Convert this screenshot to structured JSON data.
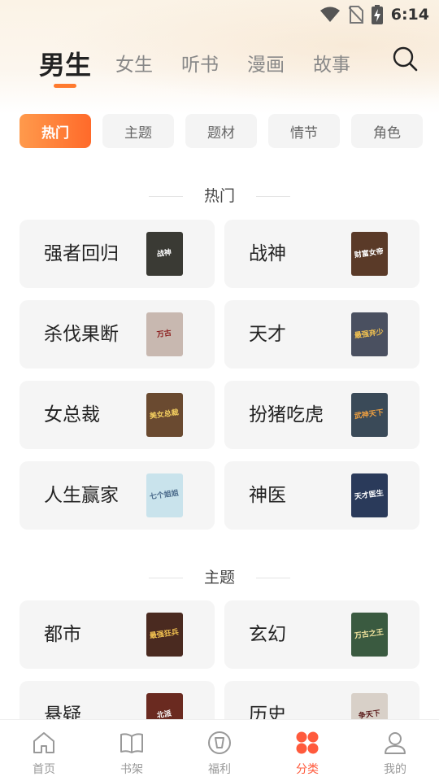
{
  "status_bar": {
    "time": "6:14"
  },
  "top_tabs": [
    {
      "label": "男生",
      "active": true
    },
    {
      "label": "女生"
    },
    {
      "label": "听书"
    },
    {
      "label": "漫画"
    },
    {
      "label": "故事"
    }
  ],
  "search": {
    "icon": "search-icon"
  },
  "chips": [
    {
      "label": "热门",
      "active": true
    },
    {
      "label": "主题"
    },
    {
      "label": "题材"
    },
    {
      "label": "情节"
    },
    {
      "label": "角色"
    }
  ],
  "sections": [
    {
      "title": "热门",
      "cards": [
        {
          "label": "强者回归",
          "cover_text": "战神",
          "cover_color": "#3a3a34"
        },
        {
          "label": "战神",
          "cover_text": "财富女帝",
          "cover_color": "#5a3a28"
        },
        {
          "label": "杀伐果断",
          "cover_text": "万古",
          "cover_color": "#c8b8b0"
        },
        {
          "label": "天才",
          "cover_text": "最强弃少",
          "cover_color": "#4a5060"
        },
        {
          "label": "女总裁",
          "cover_text": "美女总裁",
          "cover_color": "#6a4a30"
        },
        {
          "label": "扮猪吃虎",
          "cover_text": "武神天下",
          "cover_color": "#3a4a58"
        },
        {
          "label": "人生赢家",
          "cover_text": "七个姐姐",
          "cover_color": "#c9e3ec"
        },
        {
          "label": "神医",
          "cover_text": "天才医生",
          "cover_color": "#2a3a5a"
        }
      ]
    },
    {
      "title": "主题",
      "cards": [
        {
          "label": "都市",
          "cover_text": "最强狂兵",
          "cover_color": "#4a2a20"
        },
        {
          "label": "玄幻",
          "cover_text": "万古之王",
          "cover_color": "#3a5a40"
        },
        {
          "label": "悬疑",
          "cover_text": "北派",
          "cover_color": "#6a2a20"
        },
        {
          "label": "历史",
          "cover_text": "争天下",
          "cover_color": "#d8d0c8"
        }
      ]
    }
  ],
  "bottom_nav": [
    {
      "label": "首页",
      "icon": "home-icon"
    },
    {
      "label": "书架",
      "icon": "bookshelf-icon"
    },
    {
      "label": "福利",
      "icon": "welfare-icon"
    },
    {
      "label": "分类",
      "icon": "category-icon",
      "active": true
    },
    {
      "label": "我的",
      "icon": "profile-icon"
    }
  ],
  "colors": {
    "accent": "#ff6a2a",
    "nav_active": "#ff5a3c",
    "card_bg": "#f5f5f5"
  }
}
